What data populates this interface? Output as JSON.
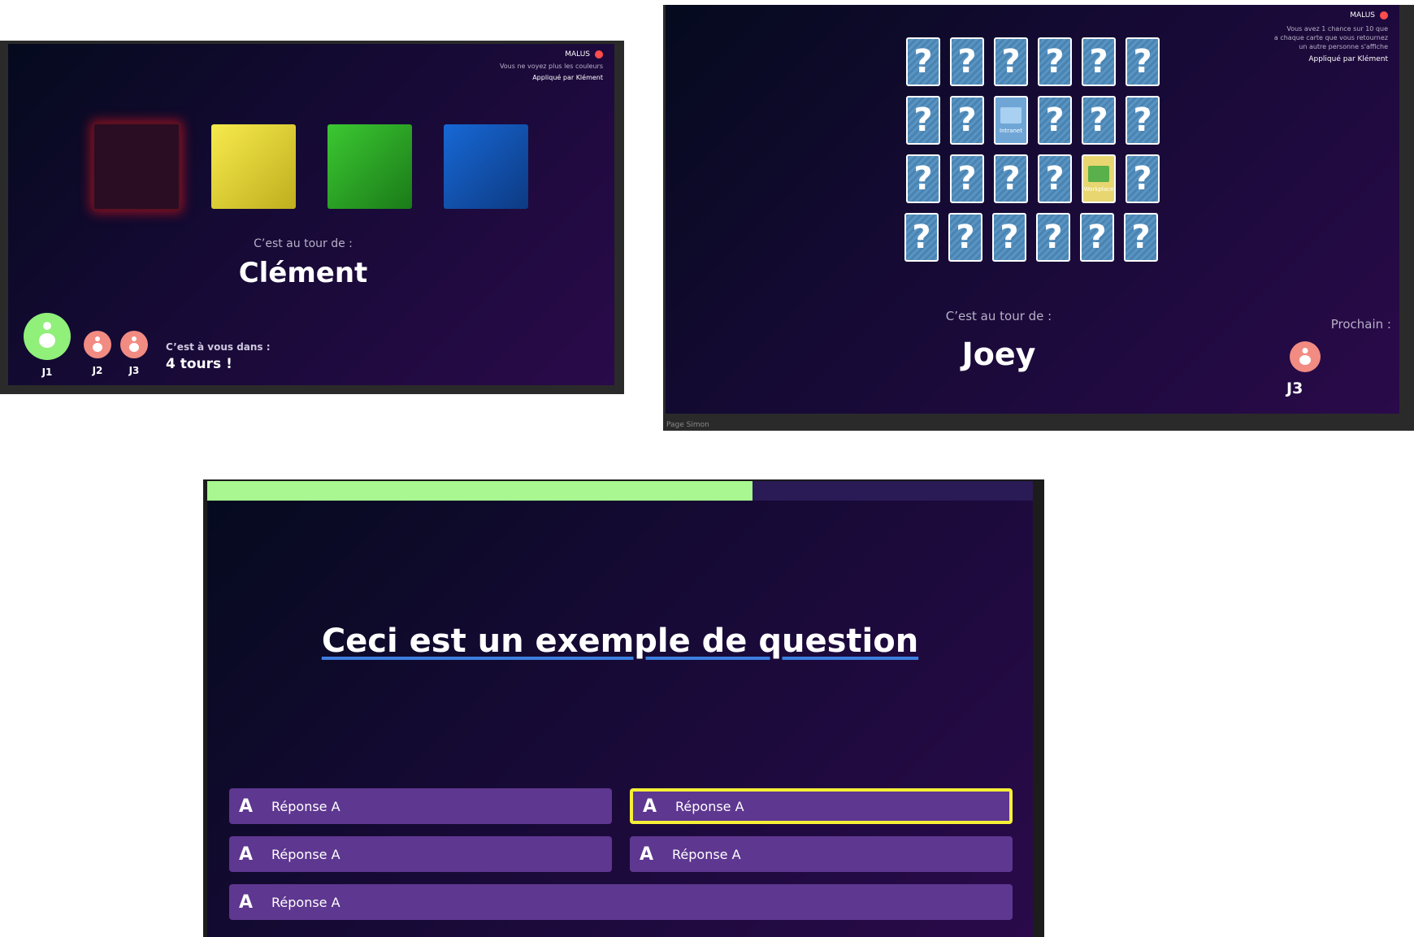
{
  "simon": {
    "malus": {
      "title": "MALUS",
      "description": "Vous ne voyez plus les couleurs",
      "applied_by": "Appliqué par Klément"
    },
    "colors": [
      "red",
      "yellow",
      "green",
      "blue"
    ],
    "turn_label": "C’est au tour de :",
    "current_player": "Clément",
    "players": [
      {
        "label": "J1",
        "active": true
      },
      {
        "label": "J2",
        "active": false
      },
      {
        "label": "J3",
        "active": false
      }
    ],
    "your_turn_in": "C’est à vous dans :",
    "turns_left": "4 tours !"
  },
  "memory": {
    "malus": {
      "title": "MALUS",
      "description": "Vous avez 1 chance sur 10 que\na chaque carte que vous retournez\nun autre personne s'affiche",
      "applied_by": "Appliqué par Klément"
    },
    "card_back_symbol": "?",
    "revealed": [
      {
        "row": 1,
        "col": 2,
        "caption": "Intranet"
      },
      {
        "row": 2,
        "col": 4,
        "caption": "Workplace"
      }
    ],
    "turn_label": "C’est au tour de :",
    "current_player": "Joey",
    "next_label": "Prochain :",
    "next_player": "J3",
    "footer": "Page Simon"
  },
  "quiz": {
    "progress": 0.66,
    "question": "Ceci est un exemple de question",
    "answers": [
      {
        "letter": "A",
        "text": "Réponse A",
        "selected": false
      },
      {
        "letter": "A",
        "text": "Réponse A",
        "selected": true
      },
      {
        "letter": "A",
        "text": "Réponse A",
        "selected": false
      },
      {
        "letter": "A",
        "text": "Réponse A",
        "selected": false
      },
      {
        "letter": "A",
        "text": "Réponse A",
        "selected": false
      }
    ]
  },
  "colors": {
    "active_player": "#90f07a",
    "inactive_player": "#f28b82",
    "malus_dot": "#ff4d4d",
    "answer_bg": "#5e3790",
    "selected_border": "#f5f036",
    "progress_fill": "#a8f790"
  }
}
